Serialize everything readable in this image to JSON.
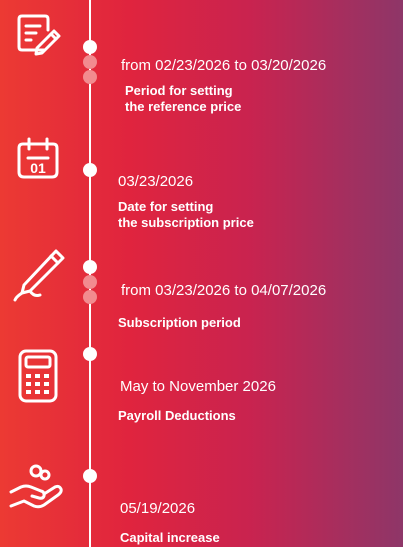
{
  "steps": [
    {
      "date": "from 02/23/2026 to 03/20/2026",
      "label": "Period for setting\nthe reference price",
      "icon": "document-pen-icon"
    },
    {
      "date": "03/23/2026",
      "label": "Date for setting\nthe subscription price",
      "icon": "calendar-icon"
    },
    {
      "date": "from 03/23/2026 to 04/07/2026",
      "label": "Subscription period",
      "icon": "pen-icon"
    },
    {
      "date": "May to November 2026",
      "label": "Payroll Deductions",
      "icon": "calculator-icon"
    },
    {
      "date": "05/19/2026",
      "label": "Capital increase",
      "icon": "hand-coins-icon"
    }
  ],
  "colors": {
    "accent_dot": "#f28b8f",
    "text": "#ffffff"
  }
}
